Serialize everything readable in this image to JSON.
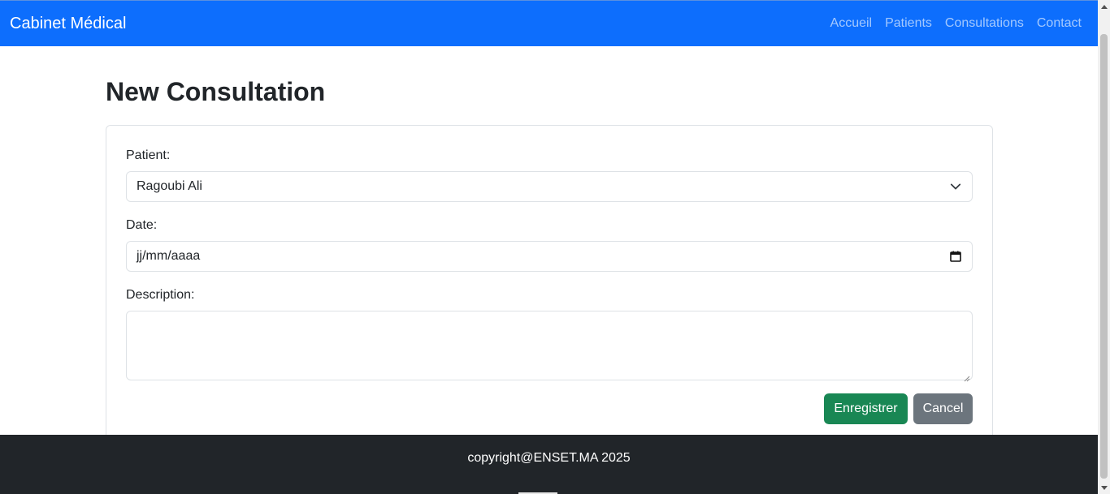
{
  "navbar": {
    "brand": "Cabinet Médical",
    "links": [
      "Accueil",
      "Patients",
      "Consultations",
      "Contact"
    ],
    "color": "#0d6efd"
  },
  "page": {
    "title": "New Consultation"
  },
  "form": {
    "patient_label": "Patient:",
    "patient_selected": "Ragoubi Ali",
    "date_label": "Date:",
    "date_placeholder": "jj/mm/aaaa",
    "description_label": "Description:",
    "description_value": "",
    "save_label": "Enregistrer",
    "cancel_label": "Cancel"
  },
  "footer": {
    "text": "copyright@ENSET.MA 2025"
  },
  "icons": {
    "select_chevron": "chevron-down-icon",
    "date_picker": "calendar-icon"
  },
  "colors": {
    "primary": "#0d6efd",
    "success": "#198754",
    "secondary": "#6c757d",
    "footer": "#212529"
  }
}
